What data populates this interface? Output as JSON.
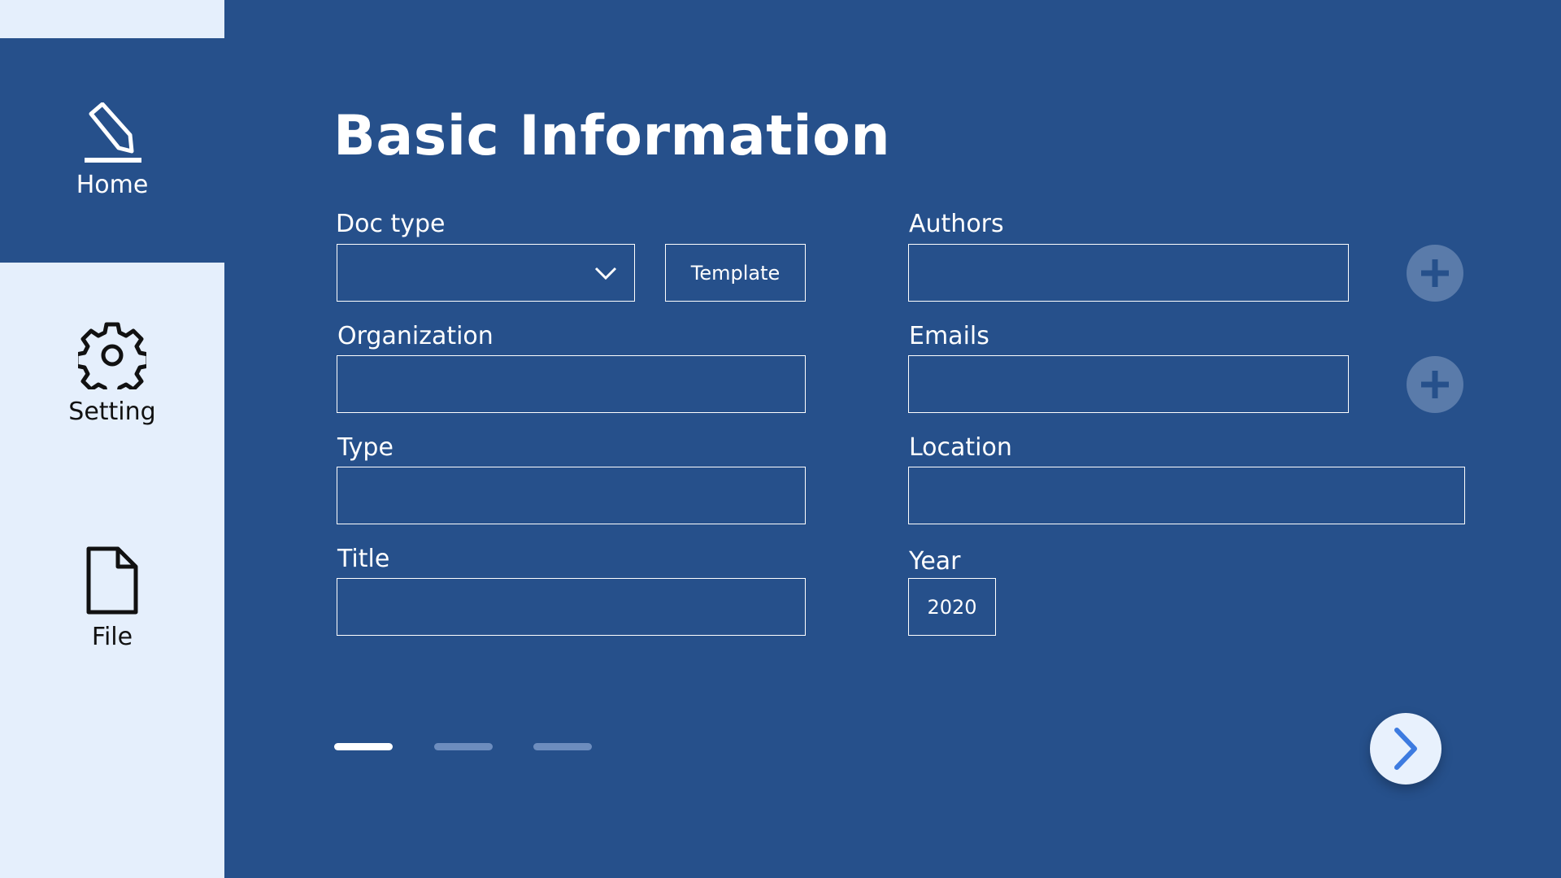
{
  "sidebar": {
    "items": [
      {
        "label": "Home",
        "icon": "pencil-icon",
        "active": true
      },
      {
        "label": "Setting",
        "icon": "gear-icon",
        "active": false
      },
      {
        "label": "File",
        "icon": "file-icon",
        "active": false
      }
    ]
  },
  "page": {
    "title": "Basic Information"
  },
  "form": {
    "doc_type": {
      "label": "Doc type",
      "value": "",
      "template_button": "Template"
    },
    "organization": {
      "label": "Organization",
      "value": ""
    },
    "type": {
      "label": "Type",
      "value": ""
    },
    "title": {
      "label": "Title",
      "value": ""
    },
    "authors": {
      "label": "Authors",
      "value": ""
    },
    "emails": {
      "label": "Emails",
      "value": ""
    },
    "location": {
      "label": "Location",
      "value": ""
    },
    "year": {
      "label": "Year",
      "value": "2020"
    }
  },
  "pagination": {
    "total_steps": 3,
    "current_step": 1
  },
  "colors": {
    "main_bg": "#26508B",
    "sidebar_bg": "#E5EFFC",
    "accent": "#3D7BE0",
    "add_button": "#5A7BAA"
  }
}
